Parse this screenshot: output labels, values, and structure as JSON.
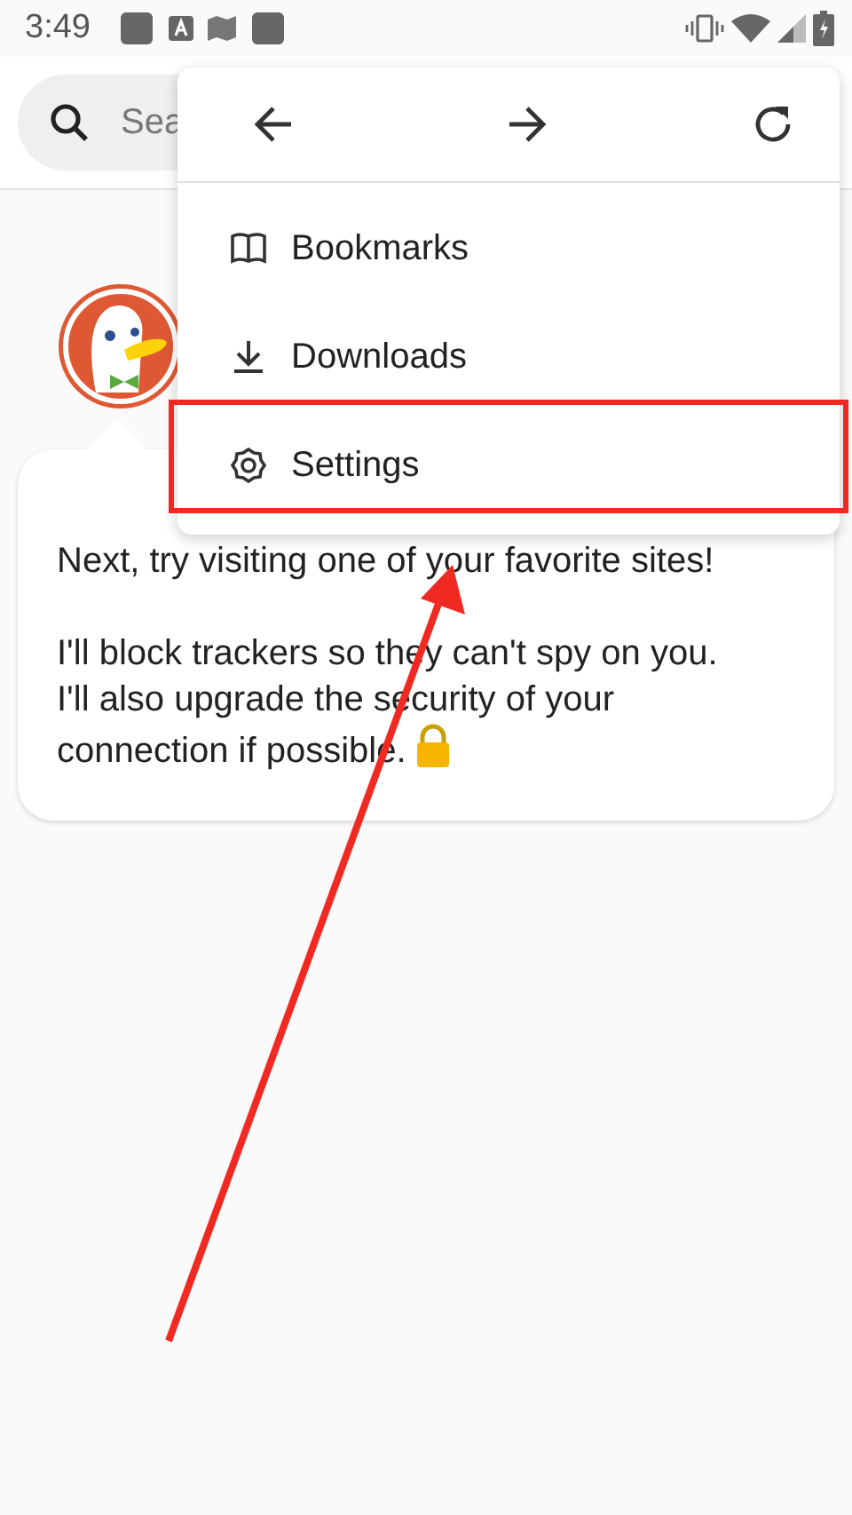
{
  "status_bar": {
    "time": "3:49"
  },
  "search": {
    "placeholder": "Sea"
  },
  "menu": {
    "nav": [
      {
        "kind": "back"
      },
      {
        "kind": "forward"
      },
      {
        "kind": "reload"
      }
    ],
    "items": [
      {
        "kind": "bookmarks",
        "label": "Bookmarks",
        "highlighted": false
      },
      {
        "kind": "downloads",
        "label": "Downloads",
        "highlighted": false
      },
      {
        "kind": "settings",
        "label": "Settings",
        "highlighted": true
      }
    ]
  },
  "dialog": {
    "paragraphs": [
      [
        "Next, try visiting one of your favorite sites!"
      ],
      [
        "I'll block trackers so they can't spy on you.",
        "I'll also upgrade the security of your connection if possible."
      ]
    ]
  }
}
